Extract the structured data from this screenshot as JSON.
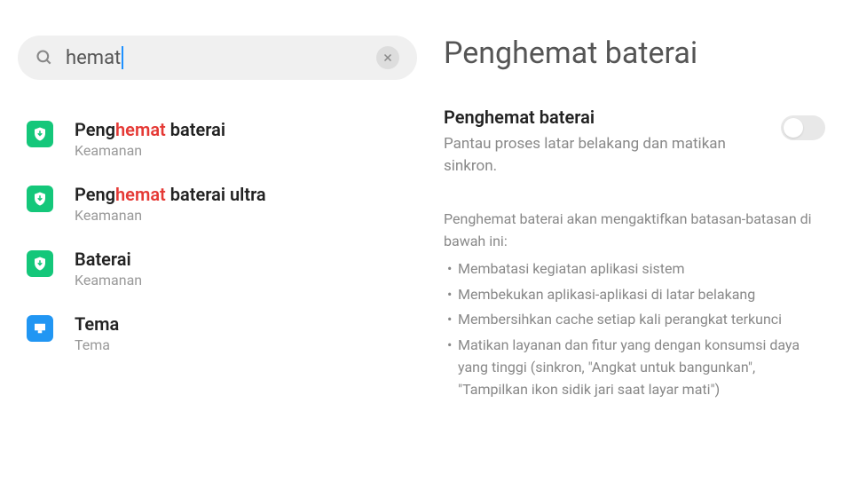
{
  "search": {
    "query": "hemat",
    "placeholder": ""
  },
  "results": [
    {
      "icon": "shield",
      "title_pre": "Peng",
      "title_hl": "hemat",
      "title_post": " baterai",
      "subtitle": "Keamanan"
    },
    {
      "icon": "shield",
      "title_pre": "Peng",
      "title_hl": "hemat",
      "title_post": " baterai ultra",
      "subtitle": "Keamanan"
    },
    {
      "icon": "shield",
      "title_pre": "Baterai",
      "title_hl": "",
      "title_post": "",
      "subtitle": "Keamanan"
    },
    {
      "icon": "theme",
      "title_pre": "Tema",
      "title_hl": "",
      "title_post": "",
      "subtitle": "Tema"
    }
  ],
  "detail": {
    "heading": "Penghemat baterai",
    "setting_title": "Penghemat baterai",
    "setting_desc": "Pantau proses latar belakang dan matikan sinkron.",
    "toggle_on": false,
    "info_lead": "Penghemat baterai akan mengaktifkan batasan-batasan di bawah ini:",
    "bullets": [
      "Membatasi kegiatan aplikasi sistem",
      "Membekukan aplikasi-aplikasi di latar belakang",
      "Membersihkan cache setiap kali perangkat terkunci",
      "Matikan layanan dan fitur yang dengan konsumsi daya yang tinggi (sinkron, \"Angkat untuk bangunkan\", \"Tampilkan ikon sidik jari saat layar mati\")"
    ]
  }
}
